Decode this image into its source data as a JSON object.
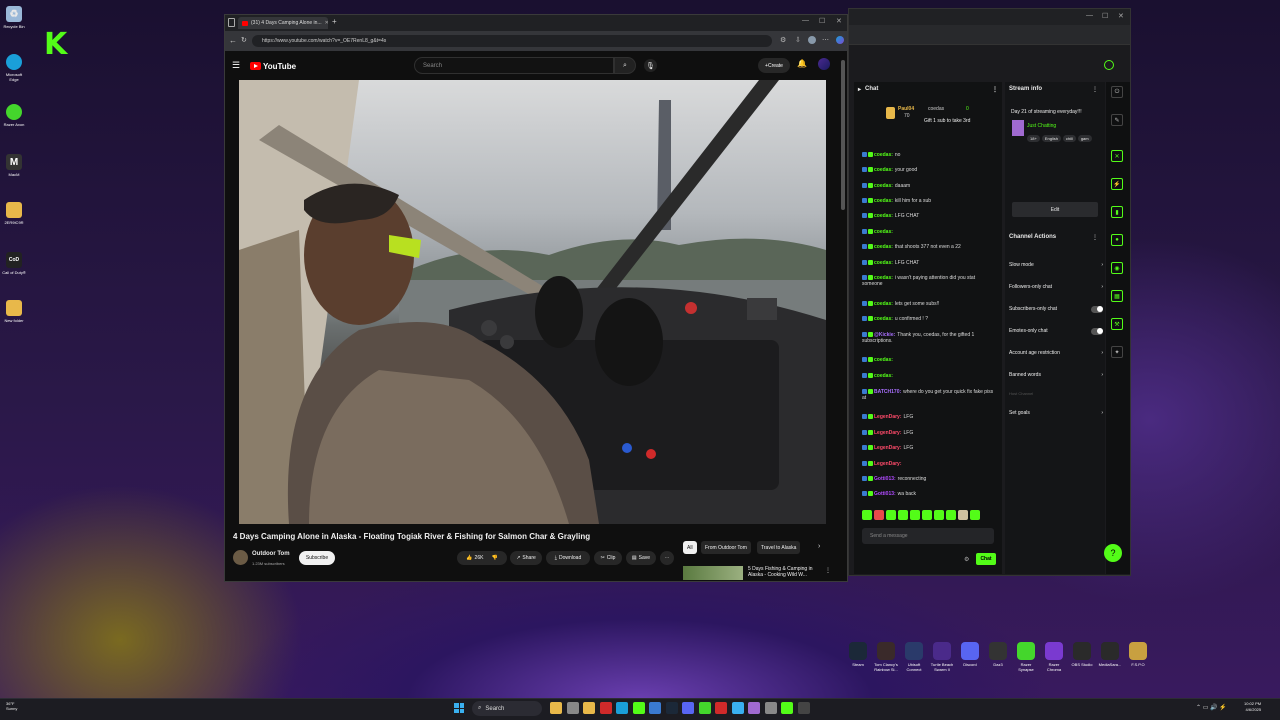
{
  "desktop": {
    "icons": [
      {
        "label": "Recycle Bin",
        "icon": "recycle-bin-icon",
        "color": "#9ab8d8"
      },
      {
        "label": "Microsoft Edge",
        "icon": "edge-icon",
        "color": "#1a9fd9"
      },
      {
        "label": "Razer Axon",
        "icon": "razer-axon-icon",
        "color": "#44d62c"
      },
      {
        "label": "MacM",
        "icon": "macm-icon",
        "color": "#333333"
      },
      {
        "label": "2ER9IC9R",
        "icon": "folder-icon",
        "color": "#e8b84a"
      },
      {
        "label": "Call of Duty®",
        "icon": "cod-icon",
        "color": "#222222"
      },
      {
        "label": "New folder",
        "icon": "folder-icon",
        "color": "#e8b84a"
      }
    ],
    "dock": [
      {
        "label": "Steam",
        "color": "#1b2838"
      },
      {
        "label": "Tom Clancy's Rainbow Si...",
        "color": "#3a2a2a"
      },
      {
        "label": "Ubisoft Connect",
        "color": "#2a3a6a"
      },
      {
        "label": "Turtle Beach Swarm II",
        "color": "#4a2a8a"
      },
      {
        "label": "Discord",
        "color": "#5865f2"
      },
      {
        "label": "Daz3",
        "color": "#333333"
      },
      {
        "label": "Razer Synapse",
        "color": "#44d62c"
      },
      {
        "label": "Razer Chroma",
        "color": "#7a3ad0"
      },
      {
        "label": "OBS Studio",
        "color": "#2a2a2a"
      },
      {
        "label": "MediaSara...",
        "color": "#2a2a2a"
      },
      {
        "label": "F.S.P.O",
        "color": "#c8a040"
      }
    ]
  },
  "browser": {
    "tab_title": "(31) 4 Days Camping Alone in...",
    "url": "https://www.youtube.com/watch?v=_OE7RenL8_g&t=4s"
  },
  "youtube": {
    "logo_text": "YouTube",
    "search_placeholder": "Search",
    "create_label": "Create",
    "video_title": "4 Days Camping Alone in Alaska - Floating Togiak River & Fishing for Salmon Char & Grayling",
    "channel_name": "Outdoor Tom",
    "subscribers": "1.23M subscribers",
    "subscribe_label": "Subscribe",
    "likes": "26K",
    "share_label": "Share",
    "download_label": "Download",
    "clip_label": "Clip",
    "save_label": "Save",
    "chips": [
      "All",
      "From Outdoor Tom",
      "Travel to Alaska"
    ],
    "rec_title": "5 Days Fishing & Camping in Alaska - Cooking Wild W..."
  },
  "chat": {
    "title": "Chat",
    "pinned_user1": "Paul04",
    "pinned_user2": "coedas",
    "pinned_count1": "70",
    "pinned_count2": "0",
    "pinned_text": "Gift 1 sub to take 3rd",
    "messages": [
      {
        "user": "coedas:",
        "text": "no",
        "color": "#53fc18"
      },
      {
        "user": "coedas:",
        "text": "your good",
        "color": "#53fc18"
      },
      {
        "user": "coedas:",
        "text": "daaam",
        "color": "#53fc18"
      },
      {
        "user": "coedas:",
        "text": "kill him for a sub",
        "color": "#53fc18"
      },
      {
        "user": "coedas:",
        "text": "LFG CHAT",
        "color": "#53fc18"
      },
      {
        "user": "coedas:",
        "text": "",
        "color": "#53fc18"
      },
      {
        "user": "coedas:",
        "text": "that shoots 377 not even a 22",
        "color": "#53fc18"
      },
      {
        "user": "coedas:",
        "text": "LFG CHAT",
        "color": "#53fc18"
      },
      {
        "user": "coedas:",
        "text": "i wasn't paying attention did you stat someone",
        "color": "#53fc18"
      },
      {
        "user": "coedas:",
        "text": "lets get some subs!!",
        "color": "#53fc18"
      },
      {
        "user": "coedas:",
        "text": "u confirmed ! ?",
        "color": "#53fc18"
      },
      {
        "user": "@Kickie:",
        "text": "Thank you, coedas, for the gifted 1 subscriptions.",
        "color": "#a970ff"
      },
      {
        "user": "coedas:",
        "text": "",
        "color": "#53fc18"
      },
      {
        "user": "coedas:",
        "text": "",
        "color": "#53fc18"
      },
      {
        "user": "BATCH170:",
        "text": "where do you get your quick fix fake piss at",
        "color": "#a970ff"
      },
      {
        "user": "LegenDary:",
        "text": "LFG",
        "color": "#ff4a6a"
      },
      {
        "user": "LegenDary:",
        "text": "LFG",
        "color": "#ff4a6a"
      },
      {
        "user": "LegenDary:",
        "text": "LFG",
        "color": "#ff4a6a"
      },
      {
        "user": "LegenDary:",
        "text": "",
        "color": "#ff4a6a"
      },
      {
        "user": "Gotti013:",
        "text": "reconnecting",
        "color": "#b04aff"
      },
      {
        "user": "Gotti013:",
        "text": "wa back",
        "color": "#b04aff"
      }
    ],
    "input_placeholder": "Send a message",
    "send_label": "Chat"
  },
  "stream_info": {
    "title": "Stream info",
    "stream_title": "Day 21 of streaming everyday!!!",
    "category": "Just Chatting",
    "tags": [
      "18+",
      "English",
      "chill",
      "gam"
    ],
    "edit_label": "Edit",
    "actions_title": "Channel Actions",
    "actions": [
      {
        "label": "Slow mode",
        "control": "chevron"
      },
      {
        "label": "Followers-only chat",
        "control": "chevron"
      },
      {
        "label": "Subscribers-only chat",
        "control": "toggle"
      },
      {
        "label": "Emotes-only chat",
        "control": "toggle"
      },
      {
        "label": "Account age restriction",
        "control": "chevron"
      },
      {
        "label": "Banned words",
        "control": "chevron"
      }
    ],
    "host_label": "Host Channel",
    "goals_label": "Set goals"
  },
  "taskbar": {
    "weather_temp": "36°F",
    "weather_desc": "Sunny",
    "search_label": "Search",
    "time": "10:02 PM",
    "date": "4/6/2025"
  },
  "colors": {
    "kick_green": "#53fc18",
    "youtube_red": "#ff0000"
  }
}
